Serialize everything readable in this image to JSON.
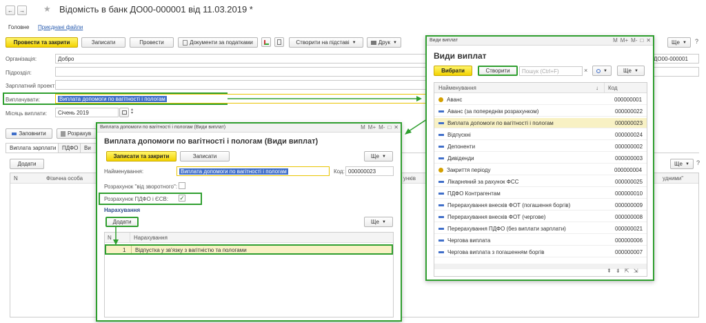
{
  "main": {
    "nav_back": "←",
    "nav_forward": "→",
    "star": "★",
    "title": "Відомість в банк ДО00-000001 від 11.03.2019 *",
    "tabs": [
      "Головне",
      "Приєднані файли"
    ],
    "toolbar": {
      "post_close": "Провести та закрити",
      "save": "Записати",
      "post": "Провести",
      "docs_taxes": "Документи за податками",
      "create_basis": "Створити на підставі",
      "print": "Друк",
      "more": "Ще",
      "help": "?"
    },
    "form": {
      "org_label": "Організація:",
      "org_value": "Добро",
      "dept_label": "Підрозділ:",
      "project_label": "Зарплатний проект:",
      "pay_label": "Виплачувати:",
      "pay_value": "Виплата допомоги по вагітності і пологам",
      "month_label": "Місяць виплати:",
      "month_value": "Січень 2019",
      "number_value": "ДО00-000001"
    },
    "fill_button": "Заповнити",
    "calc_button": "Розрахув",
    "inner_tabs": [
      "Виплата зарплати",
      "ПДФО",
      "Ви"
    ],
    "add_button": "Додати",
    "table_headers": [
      "N",
      "Фізична особа",
      "унків",
      "удними\""
    ],
    "more2": "Ще",
    "help2": "?"
  },
  "payment_types": {
    "window_title": "Види виплат",
    "ctrls": [
      "M",
      "M+",
      "M-",
      "□",
      "✕"
    ],
    "heading": "Види виплат",
    "select_button": "Вибрати",
    "create_button": "Створити",
    "search_placeholder": "Пошук (Ctrl+F)",
    "search_clear": "×",
    "more": "Ще",
    "col_name": "Найменування",
    "col_code": "Код",
    "rows": [
      {
        "name": "Аванс",
        "code": "000000001"
      },
      {
        "name": "Аванс (за попереднім розрахунком)",
        "code": "000000022"
      },
      {
        "name": "Виплата допомоги по вагітності і пологам",
        "code": "000000023"
      },
      {
        "name": "Відпускні",
        "code": "000000024"
      },
      {
        "name": "Депоненти",
        "code": "000000002"
      },
      {
        "name": "Дивіденди",
        "code": "000000003"
      },
      {
        "name": "Закриття періоду",
        "code": "000000004"
      },
      {
        "name": "Лікарняний за рахунок ФСС",
        "code": "000000025"
      },
      {
        "name": "ПДФО Контрагентам",
        "code": "000000010"
      },
      {
        "name": "Перерахування внесків ФОТ (погашення боргів)",
        "code": "000000009"
      },
      {
        "name": "Перерахування внесків ФОТ (чергове)",
        "code": "000000008"
      },
      {
        "name": "Перерахування ПДФО (без виплати зарплати)",
        "code": "000000021"
      },
      {
        "name": "Чергова виплата",
        "code": "000000006"
      },
      {
        "name": "Чергова виплата з погашенням боргів",
        "code": "000000007"
      }
    ]
  },
  "maternity": {
    "window_title": "Виплата допомоги по вагітності і пологам (Види виплат)",
    "ctrls": [
      "M",
      "M+",
      "M-",
      "□",
      "✕"
    ],
    "heading": "Виплата допомоги по вагітності і пологам (Види виплат)",
    "save_close": "Записати та закрити",
    "save": "Записати",
    "more": "Ще",
    "name_label": "Найменування:",
    "name_value": "Виплата допомоги по вагітності і пологам",
    "code_label": "Код:",
    "code_value": "000000023",
    "reverse_label": "Розрахунок \"від зворотного\":",
    "pdfo_label": "Розрахунок ПДФО і ЄСВ:",
    "check_mark": "✓",
    "accruals_title": "Нарахування",
    "add_button": "Додати",
    "more2": "Ще",
    "col_n": "N",
    "col_accrual": "Нарахування",
    "row_n": "1",
    "row_accrual": "Відпустка у зв'язку з вагітністю та пологами"
  },
  "colors": {
    "highlight_green": "#2e9e2e",
    "selection_blue": "#3f6ec9",
    "accent_yellow": "#f3d200"
  }
}
